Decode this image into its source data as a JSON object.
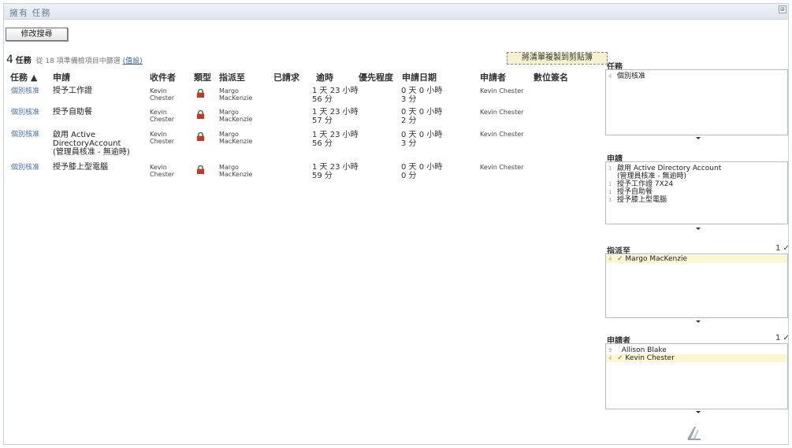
{
  "window": {
    "title": "擁有 任務"
  },
  "toolbar": {
    "modify_search": "修改搜尋"
  },
  "summary": {
    "count": "4",
    "label": "任務",
    "note": "從 18 項準備檢項目中篩選",
    "link": "(值設)"
  },
  "copy_button": "將清單複製到剪貼簿",
  "columns": {
    "task": "任務 ▲",
    "request": "申請",
    "recipient": "收件者",
    "type": "類型",
    "assigned_to": "指派至",
    "requested": "已請求",
    "overdue": "逾時",
    "priority": "優先程度",
    "request_date": "申請日期",
    "requester": "申請者",
    "digital_signature": "數位簽名"
  },
  "rows": [
    {
      "task": "個別核准",
      "request_lines": [
        "授予工作證"
      ],
      "recipient": [
        "Kevin",
        "Chester"
      ],
      "assigned": [
        "Margo",
        "MacKenzie"
      ],
      "overdue": [
        "1 天 23 小時",
        "56 分"
      ],
      "date": [
        "0 天 0 小時",
        "3 分"
      ],
      "requester": "Kevin Chester"
    },
    {
      "task": "個別核准",
      "request_lines": [
        "授予自助餐"
      ],
      "recipient": [
        "Kevin",
        "Chester"
      ],
      "assigned": [
        "Margo",
        "MacKenzie"
      ],
      "overdue": [
        "1 天 23 小時",
        "57 分"
      ],
      "date": [
        "0 天 0 小時",
        "2 分"
      ],
      "requester": "Kevin Chester"
    },
    {
      "task": "個別核准",
      "request_lines": [
        "啟用 Active",
        "DirectoryAccount",
        "(管理員核准 - 無逾時)"
      ],
      "recipient": [
        "Kevin",
        "Chester"
      ],
      "assigned": [
        "Margo",
        "MacKenzie"
      ],
      "overdue": [
        "1 天 23 小時",
        "56 分"
      ],
      "date": [
        "0 天 0 小時",
        "3 分"
      ],
      "requester": "Kevin Chester"
    },
    {
      "task": "個別核准",
      "request_lines": [
        "授予膝上型電腦"
      ],
      "recipient": [
        "Kevin",
        "Chester"
      ],
      "assigned": [
        "Margo",
        "MacKenzie"
      ],
      "overdue": [
        "1 天 23 小時",
        "59 分"
      ],
      "date": [
        "0 天 0 小時",
        "0 分"
      ],
      "requester": "Kevin Chester"
    }
  ],
  "panels": {
    "task": {
      "title": "任務",
      "items": [
        {
          "count": "4",
          "label": "個別核准",
          "checked": false
        }
      ]
    },
    "request": {
      "title": "申請",
      "items": [
        {
          "count": "1",
          "label": "啟用 Active Directory Account",
          "sub": "(管理員核准 - 無逾時)"
        },
        {
          "count": "1",
          "label": "授予工作證 7X24"
        },
        {
          "count": "1",
          "label": "授予自助餐"
        },
        {
          "count": "1",
          "label": "授予膝上型電腦"
        }
      ]
    },
    "assigned": {
      "title": "指派至",
      "check": "1 ✓",
      "items": [
        {
          "count": "4",
          "label": "Margo MacKenzie",
          "checked": true
        }
      ]
    },
    "requester": {
      "title": "申請者",
      "check": "1 ✓",
      "items": [
        {
          "count": "9",
          "label": "Allison Blake",
          "checked": false
        },
        {
          "count": "4",
          "label": "Kevin Chester",
          "checked": true
        }
      ]
    }
  },
  "colors": {
    "link": "#4a6fa8",
    "selected_row": "#fdf6d2",
    "accent_check": "#3a8a3a"
  }
}
